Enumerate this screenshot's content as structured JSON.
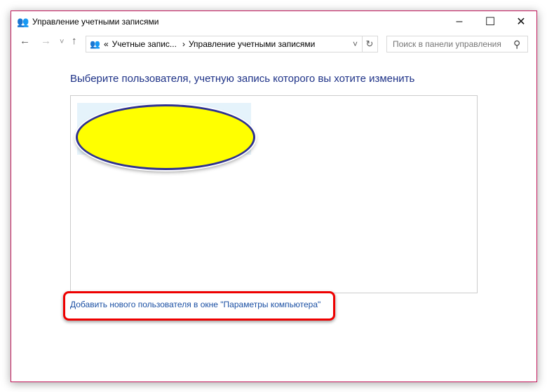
{
  "window": {
    "title": "Управление учетными записями",
    "minimize": "–",
    "maximize": "☐",
    "close": "✕"
  },
  "nav": {
    "back": "←",
    "forward": "→",
    "recent": "˅",
    "up": "↑",
    "refresh": "↻",
    "breadcrumb": {
      "prefix": "«",
      "items": [
        "Учетные запис...",
        "Управление учетными записями"
      ],
      "sep": "›",
      "dropdown": "˅"
    },
    "search_placeholder": "Поиск в панели управления",
    "search_icon": "⚲"
  },
  "main": {
    "heading": "Выберите пользователя, учетную запись которого вы хотите изменить",
    "add_user_link": "Добавить нового пользователя в окне \"Параметры компьютера\""
  }
}
